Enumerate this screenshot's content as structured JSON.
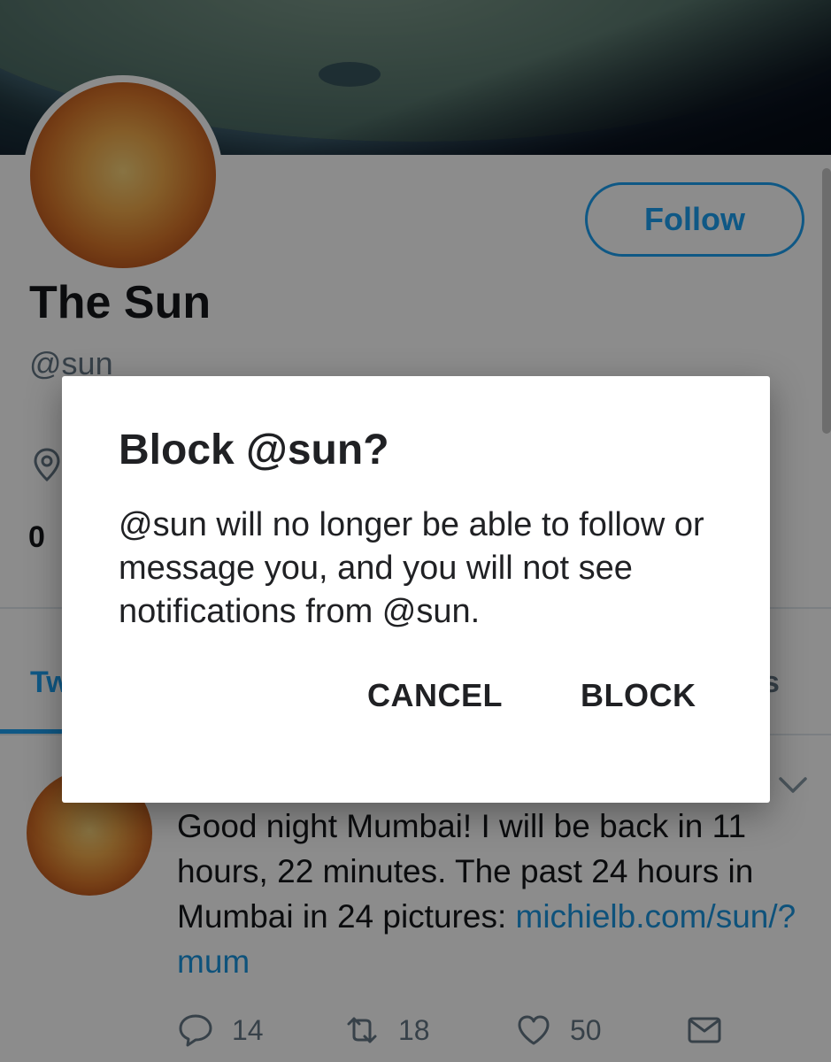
{
  "profile": {
    "name": "The Sun",
    "handle": "@sun",
    "follow_label": "Follow",
    "count_partial": "0"
  },
  "tabs": {
    "left_partial": "Tw",
    "right_partial": "s"
  },
  "tweet": {
    "text": "Good night Mumbai! I will be back in 11 hours, 22 minutes. The past 24 hours in Mumbai in 24 pictures: ",
    "link": "michielb.com/sun/?mum",
    "replies": "14",
    "retweets": "18",
    "likes": "50"
  },
  "dialog": {
    "title": "Block @sun?",
    "message": "@sun will no longer be able to follow or message you, and you will not see notifications from @sun.",
    "cancel_label": "CANCEL",
    "block_label": "BLOCK"
  },
  "colors": {
    "accent": "#1da1f2",
    "link": "#1b95e0",
    "scrim": "rgba(0,0,0,0.45)"
  },
  "icons": [
    "location-pin-icon",
    "chevron-down-icon",
    "reply-icon",
    "retweet-icon",
    "like-heart-icon",
    "direct-message-icon"
  ]
}
